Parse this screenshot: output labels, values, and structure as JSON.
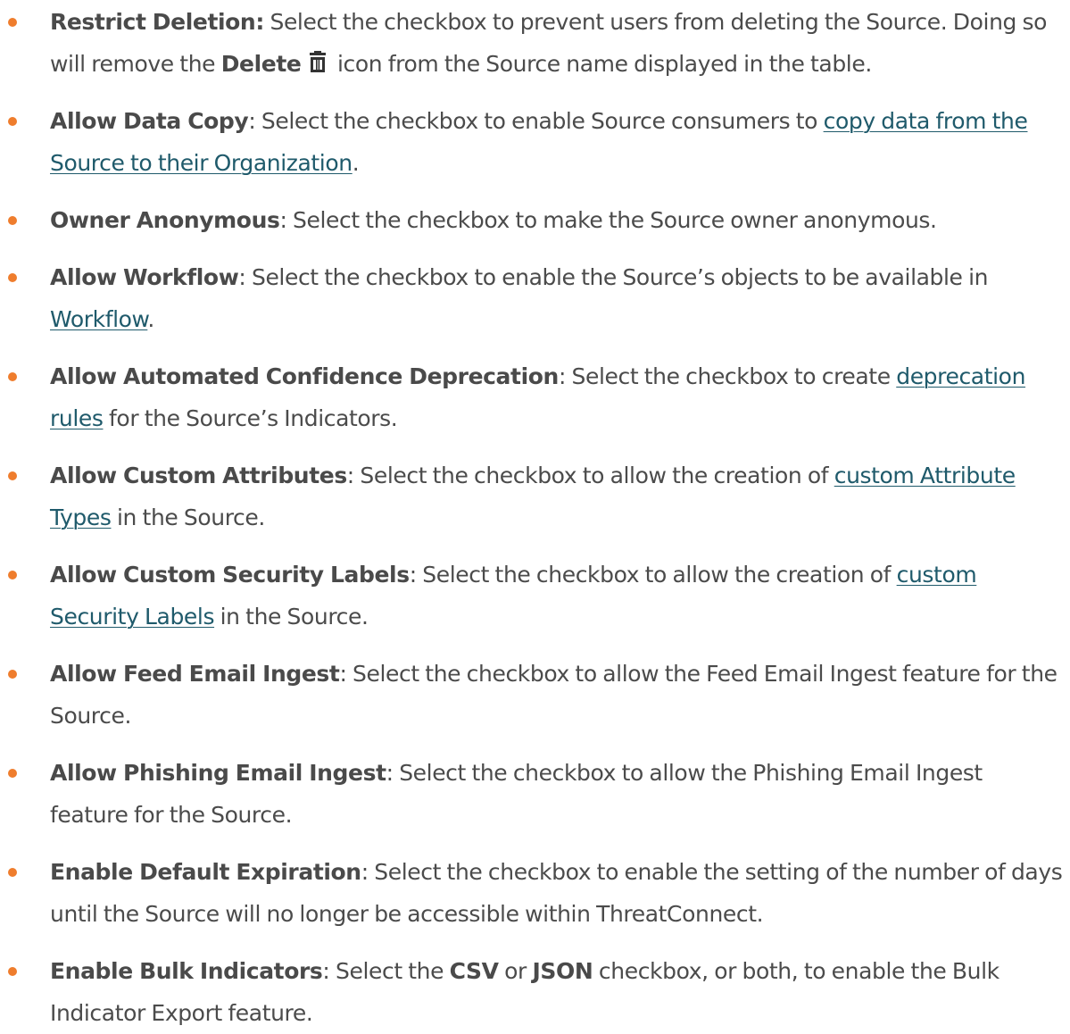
{
  "items": [
    {
      "term": "Restrict Deletion:",
      "text_before": " Select the checkbox to prevent users from deleting the Source. Doing so will remove the ",
      "bold_delete": "Delete",
      "delete_icon": "trash-icon",
      "text_after": " icon from the Source name displayed in the table."
    },
    {
      "term": "Allow Data Copy",
      "text_before": ": Select the checkbox to enable Source consumers to ",
      "link": "copy data from the Source to their Organization",
      "text_after": "."
    },
    {
      "term": "Owner Anonymous",
      "text": ": Select the checkbox to make the Source owner anonymous."
    },
    {
      "term": "Allow Workflow",
      "text_before": ": Select the checkbox to enable the Source’s objects to be available in ",
      "link": "Workflow",
      "text_after": "."
    },
    {
      "term": "Allow Automated Confidence Deprecation",
      "text_before": ": Select the checkbox to create ",
      "link": "deprecation rules",
      "text_after": " for the Source’s Indicators."
    },
    {
      "term": "Allow Custom Attributes",
      "text_before": ": Select the checkbox to allow the creation of ",
      "link": "custom Attribute Types",
      "text_after": " in the Source."
    },
    {
      "term": "Allow Custom Security Labels",
      "text_before": ": Select the checkbox to allow the creation of ",
      "link": "custom Security Labels",
      "text_after": " in the Source."
    },
    {
      "term": "Allow Feed Email Ingest",
      "text": ": Select the checkbox to allow the Feed Email Ingest feature for the Source."
    },
    {
      "term": "Allow Phishing Email Ingest",
      "text": ": Select the checkbox to allow the Phishing Email Ingest feature for the Source."
    },
    {
      "term": "Enable Default Expiration",
      "text": ": Select the checkbox to enable the setting of the number of days until the Source will no longer be accessible within ThreatConnect."
    },
    {
      "term": "Enable Bulk Indicators",
      "text_before": ": Select the ",
      "bold_csv": "CSV",
      "text_mid": " or ",
      "bold_json": "JSON",
      "text_after": " checkbox, or both, to enable the Bulk Indicator Export feature."
    }
  ],
  "colors": {
    "bullet": "#ef7d2d",
    "text": "#4b4b4b",
    "link": "#1f5a6b"
  }
}
